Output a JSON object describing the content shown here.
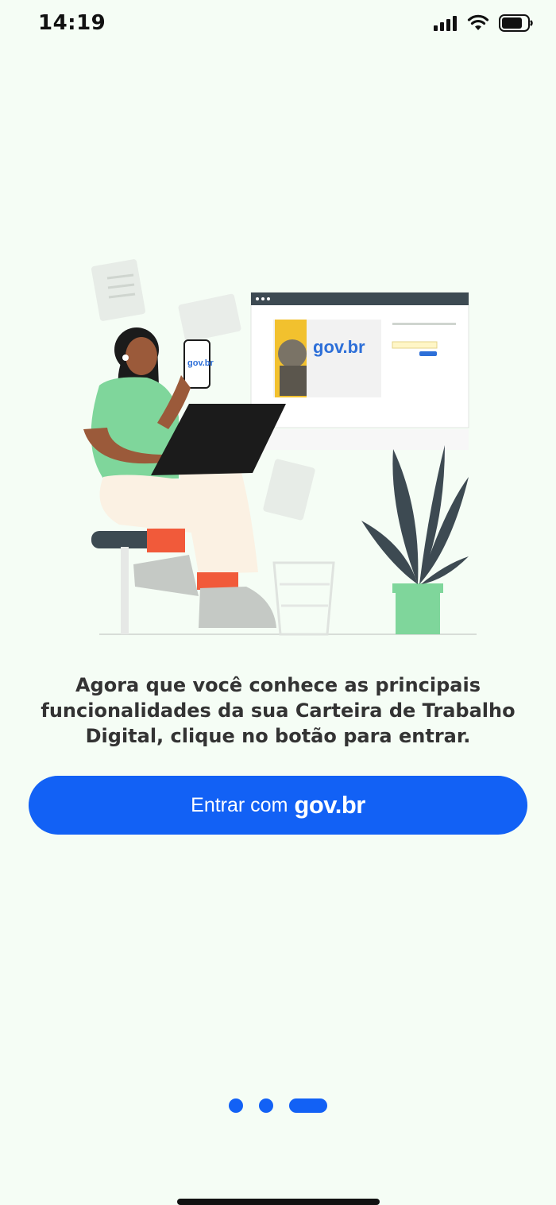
{
  "status_bar": {
    "time": "14:19",
    "icons": [
      "cellular-signal-icon",
      "wifi-icon",
      "battery-icon"
    ]
  },
  "illustration": {
    "description_icons": [
      "woman-with-phone-and-laptop",
      "browser-window",
      "plant",
      "wastebasket",
      "floating-documents"
    ],
    "phone_logo": "gov.br",
    "browser_logo": "gov.br"
  },
  "onboarding": {
    "message": "Agora que você conhece as principais funcionalidades da sua Carteira de Trabalho Digital, clique no botão para entrar."
  },
  "login_button": {
    "prefix": "Entrar com",
    "brand": "gov.br"
  },
  "pager": {
    "count": 3,
    "active_index": 2
  },
  "colors": {
    "background": "#f5fdf5",
    "primary": "#1261f5",
    "text": "#333333"
  }
}
